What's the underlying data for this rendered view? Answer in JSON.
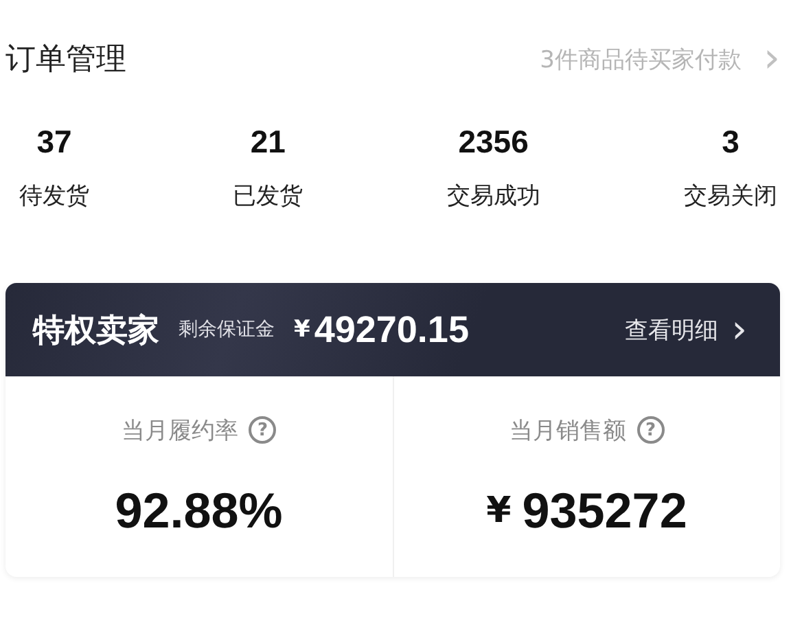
{
  "header": {
    "title": "订单管理",
    "link": "3件商品待买家付款",
    "chevron": "›"
  },
  "stats": [
    {
      "value": "37",
      "label": "待发货"
    },
    {
      "value": "21",
      "label": "已发货"
    },
    {
      "value": "2356",
      "label": "交易成功"
    },
    {
      "value": "3",
      "label": "交易关闭"
    }
  ],
  "seller_card": {
    "title": "特权卖家",
    "deposit_label": "剩余保证金",
    "currency": "¥",
    "deposit": "49270.15",
    "detail_link": "查看明细",
    "chevron": "›"
  },
  "metrics": [
    {
      "label": "当月履约率",
      "help": "?",
      "value": "92.88%"
    },
    {
      "label": "当月销售额",
      "help": "?",
      "currency": "¥",
      "value": "935272"
    }
  ]
}
